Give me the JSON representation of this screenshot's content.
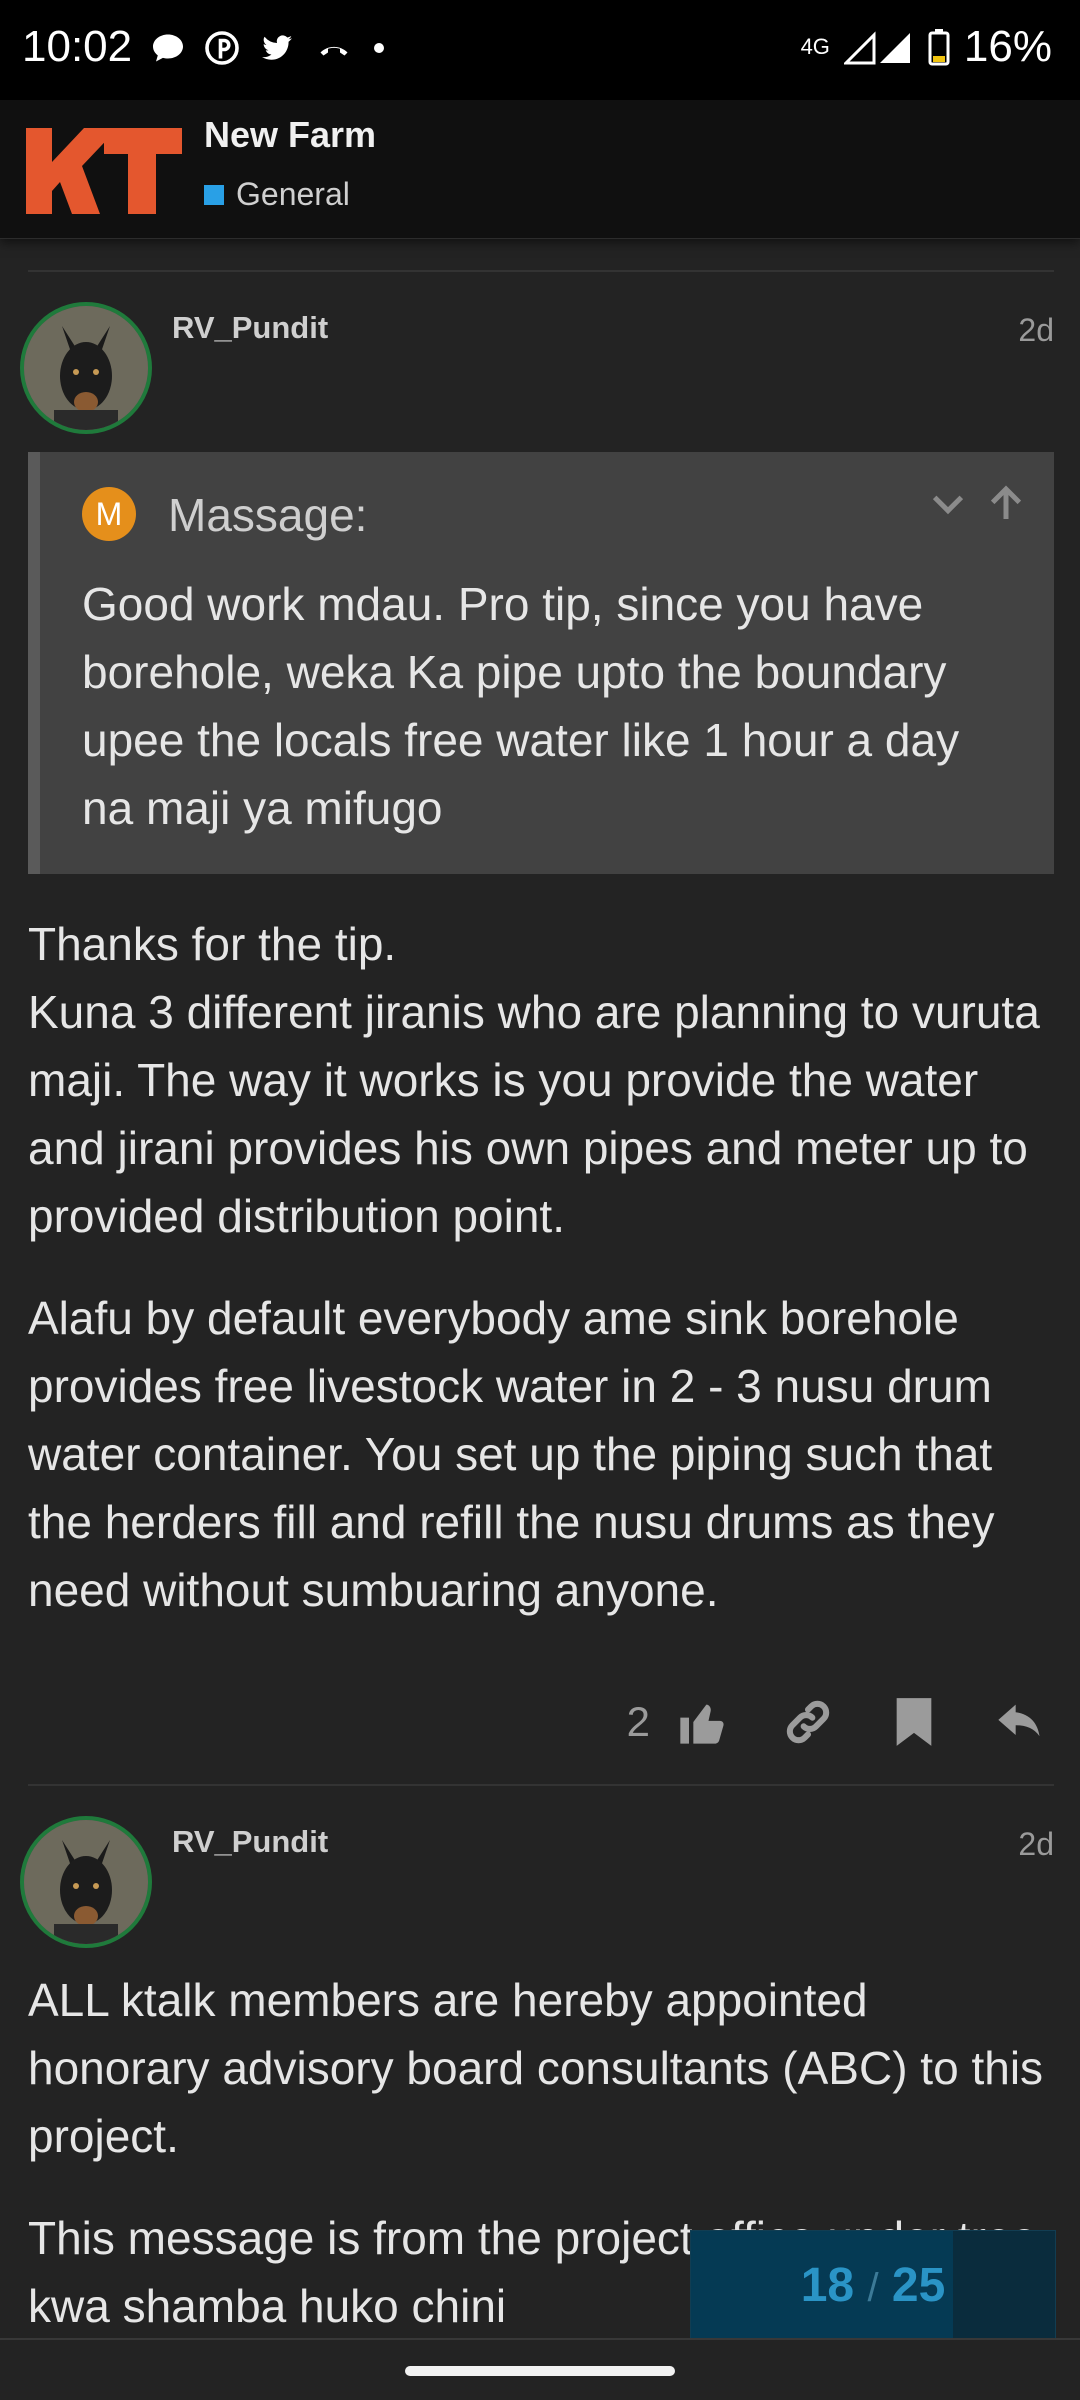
{
  "status_bar": {
    "time": "10:02",
    "notification_icons": [
      "chat-bubble-icon",
      "pinterest-icon",
      "twitter-icon",
      "missed-call-icon",
      "dot-icon"
    ],
    "network": "4G",
    "battery": "16%"
  },
  "topic": {
    "logo_text": "KT",
    "title": "New Farm",
    "category": "General",
    "category_color": "#29a0e6"
  },
  "posts": [
    {
      "username": "RV_Pundit",
      "date": "2d",
      "quote": {
        "avatar_letter": "M",
        "username": "Massage:",
        "text": "Good work mdau. Pro tip, since you have borehole, weka Ka pipe upto the boundary upee the locals free water like 1 hour a day na maji ya mifugo"
      },
      "paragraphs": [
        "Thanks for the tip.\nKuna 3 different jiranis who are planning to vuruta maji. The way it works is you provide the water and jirani provides his own pipes and meter up to provided distribution point.",
        "Alafu by default everybody ame sink borehole provides free livestock water in 2 - 3 nusu drum water container. You set up the piping such that the herders fill and refill the nusu drums as they need without sumbuaring anyone."
      ],
      "like_count": "2"
    },
    {
      "username": "RV_Pundit",
      "date": "2d",
      "paragraphs": [
        "ALL ktalk members are hereby appointed honorary advisory board consultants (ABC) to this project.",
        "This message is from the project office under tree kwa shamba huko chini"
      ]
    }
  ],
  "progress": {
    "current": "18",
    "separator": "/",
    "total": "25",
    "fraction": 0.72
  },
  "colors": {
    "accent_orange": "#e4572e",
    "quote_avatar": "#e58f1b",
    "progress_text": "#2a94c6"
  }
}
